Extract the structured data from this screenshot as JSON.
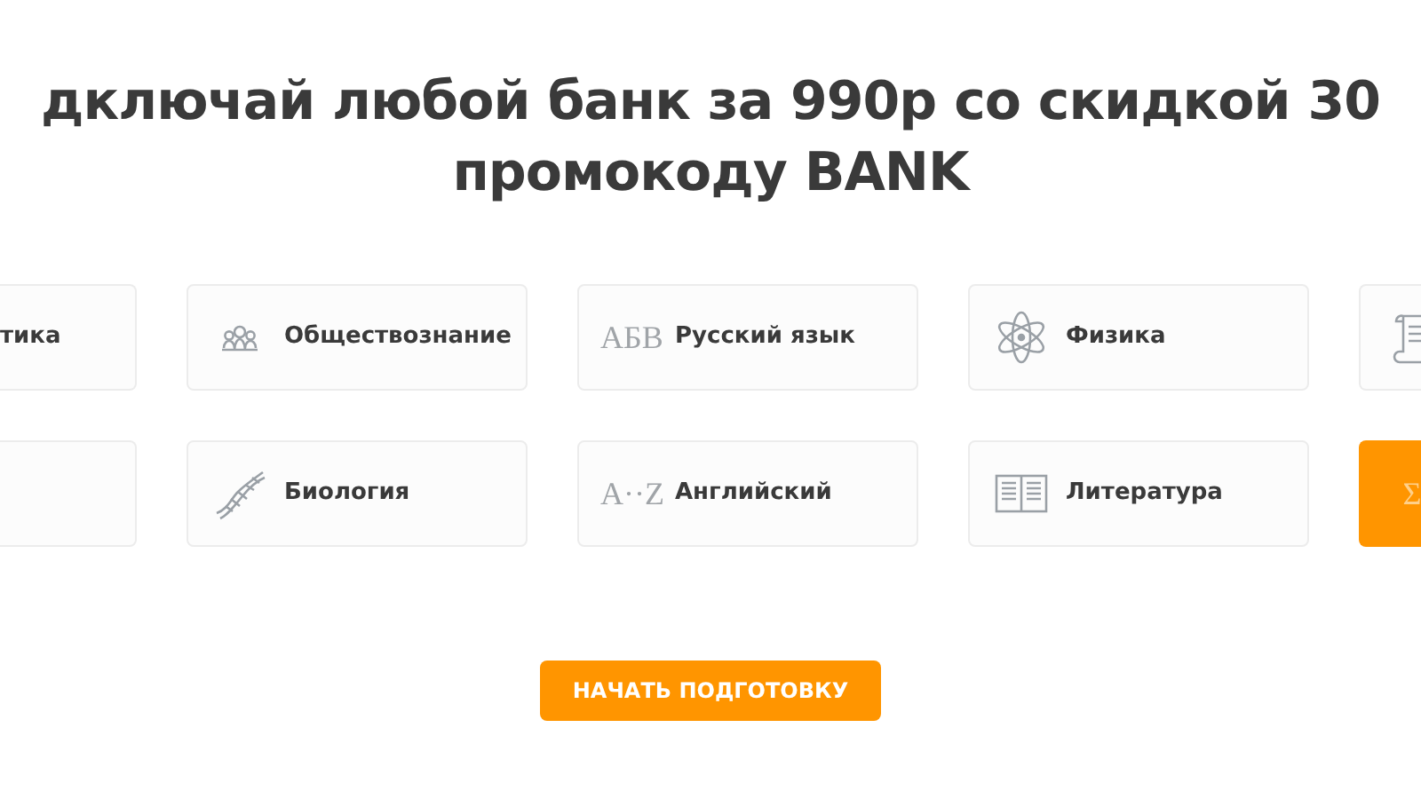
{
  "heading": [
    "дключай любой банк за 990р со скидкой 30",
    "промокоду BANK"
  ],
  "rows": [
    [
      {
        "kind": "cut-left",
        "label": "тика",
        "selected": false
      },
      {
        "kind": "full",
        "label": "Обществознание",
        "selected": false
      },
      {
        "kind": "full",
        "icon_text": "АБВ",
        "label": "Русский язык",
        "selected": false
      },
      {
        "kind": "full",
        "label": "Физика",
        "selected": false
      },
      {
        "kind": "cut-right",
        "selected": false
      }
    ],
    [
      {
        "kind": "cut-left",
        "selected": false
      },
      {
        "kind": "full",
        "label": "Биология",
        "selected": false
      },
      {
        "kind": "full",
        "icon_text": "A··Z",
        "label": "Английский",
        "selected": false
      },
      {
        "kind": "full",
        "label": "Литература",
        "selected": false
      },
      {
        "kind": "cut-right",
        "icon_text": "Σ",
        "selected": true
      }
    ]
  ],
  "button": "НАЧАТЬ ПОДГОТОВКУ"
}
